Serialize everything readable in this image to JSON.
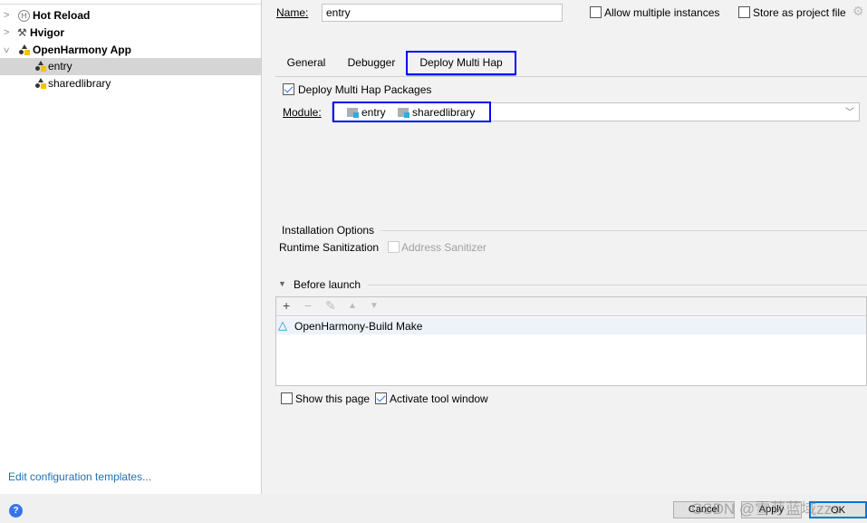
{
  "tree": {
    "items": [
      {
        "label": "Hot Reload",
        "icon": "hot-reload-icon",
        "expanded": false
      },
      {
        "label": "Hvigor",
        "icon": "hammer-icon",
        "expanded": false
      },
      {
        "label": "OpenHarmony App",
        "icon": "openharmony-app-icon",
        "expanded": true
      },
      {
        "label": "entry",
        "icon": "openharmony-app-icon",
        "selected": true
      },
      {
        "label": "sharedlibrary",
        "icon": "openharmony-app-icon"
      }
    ]
  },
  "edit_templates_link": "Edit configuration templates...",
  "name_label": "Name:",
  "name_value": "entry",
  "allow_multiple": {
    "label": "Allow multiple instances",
    "checked": false
  },
  "store_project": {
    "label": "Store as project file",
    "checked": false
  },
  "tabs": [
    {
      "label": "General"
    },
    {
      "label": "Debugger"
    },
    {
      "label": "Deploy Multi Hap",
      "active": true
    }
  ],
  "deploy_packages": {
    "label": "Deploy Multi Hap Packages",
    "checked": true
  },
  "module_label": "Module:",
  "modules": [
    "entry",
    "sharedlibrary"
  ],
  "installation_options": "Installation Options",
  "runtime_sanitization": "Runtime Sanitization",
  "address_sanitizer": {
    "label": "Address Sanitizer",
    "checked": false,
    "enabled": false
  },
  "before_launch": "Before launch",
  "before_launch_tasks": [
    {
      "label": "OpenHarmony-Build Make"
    }
  ],
  "show_page": {
    "label": "Show this page",
    "checked": false
  },
  "activate_tool": {
    "label": "Activate tool window",
    "checked": true
  },
  "buttons": {
    "cancel": "Cancel",
    "apply": "Apply",
    "ok": "OK"
  },
  "watermark": "CSDN @雪芽蓝域zzs",
  "colors": {
    "accent": "#3574f0",
    "highlight_box": "#0000ff",
    "selection": "#d5d5d5",
    "link": "#2470b3"
  }
}
